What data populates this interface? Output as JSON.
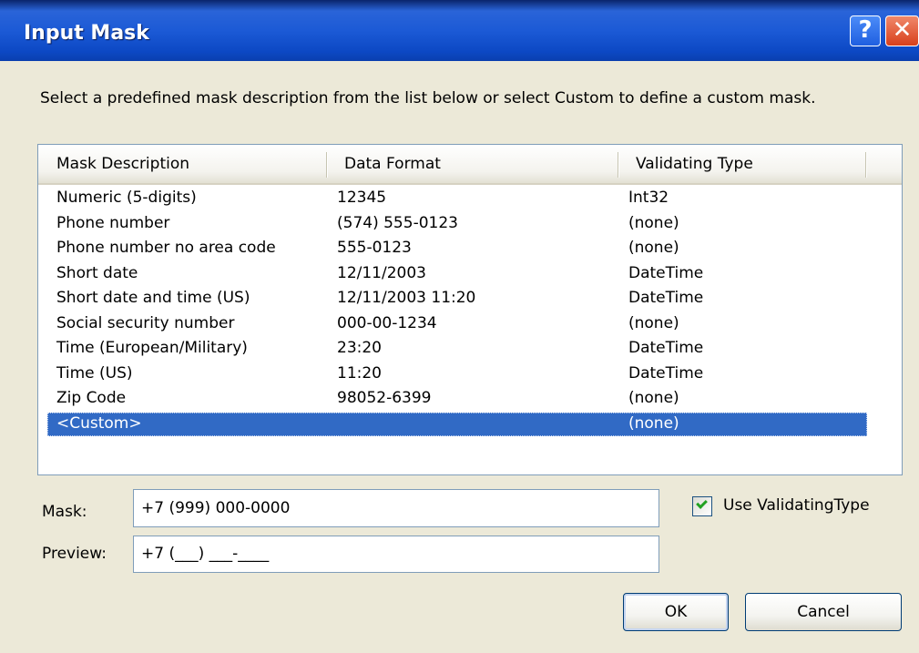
{
  "window": {
    "title": "Input Mask",
    "help_glyph": "?",
    "close_glyph": "✕"
  },
  "instructions": "Select a predefined mask description from the list below or select Custom to define a custom mask.",
  "list": {
    "columns": [
      "Mask Description",
      "Data Format",
      "Validating Type"
    ],
    "rows": [
      {
        "description": "Numeric (5-digits)",
        "format": "12345",
        "type": "Int32"
      },
      {
        "description": "Phone number",
        "format": "(574) 555-0123",
        "type": "(none)"
      },
      {
        "description": "Phone number no area code",
        "format": "555-0123",
        "type": "(none)"
      },
      {
        "description": "Short date",
        "format": "12/11/2003",
        "type": "DateTime"
      },
      {
        "description": "Short date and time (US)",
        "format": "12/11/2003 11:20",
        "type": "DateTime"
      },
      {
        "description": "Social security number",
        "format": "000-00-1234",
        "type": "(none)"
      },
      {
        "description": "Time (European/Military)",
        "format": "23:20",
        "type": "DateTime"
      },
      {
        "description": "Time (US)",
        "format": "11:20",
        "type": "DateTime"
      },
      {
        "description": "Zip Code",
        "format": "98052-6399",
        "type": "(none)"
      },
      {
        "description": "<Custom>",
        "format": "",
        "type": "(none)",
        "selected": true
      }
    ]
  },
  "mask": {
    "label": "Mask:",
    "value": "+7 (999) 000-0000"
  },
  "preview": {
    "label": "Preview:",
    "value": "+7 (___) ___-____"
  },
  "use_validating_type": {
    "label": "Use ValidatingType",
    "checked": true
  },
  "buttons": {
    "ok": "OK",
    "cancel": "Cancel"
  },
  "colors": {
    "selection": "#316ac5",
    "titlebar": "#0c48c4",
    "face": "#ece9d8",
    "check": "#21a121"
  }
}
